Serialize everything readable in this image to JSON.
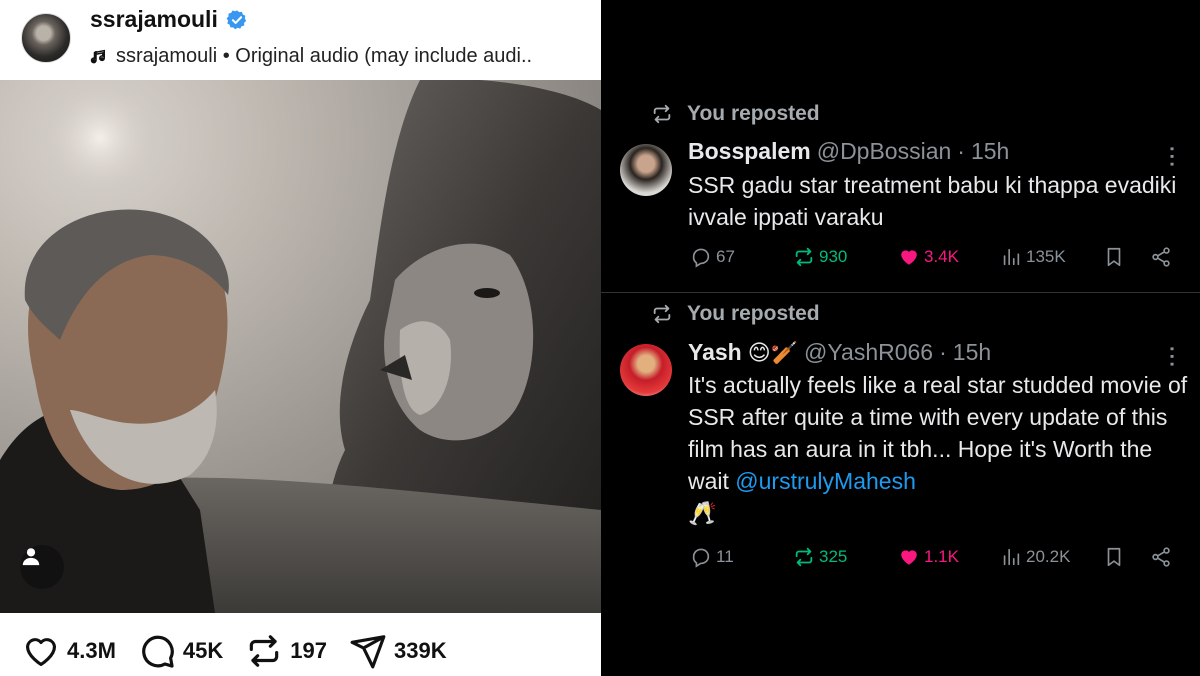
{
  "instagram": {
    "username": "ssrajamouli",
    "audio_label": "ssrajamouli • Original audio (may include audi..",
    "actions": {
      "likes": "4.3M",
      "comments": "45K",
      "reposts": "197",
      "shares": "339K"
    }
  },
  "x_feed": {
    "posts": [
      {
        "repost_label": "You reposted",
        "name": "Bosspalem",
        "name_emoji": "",
        "handle": "@DpBossian",
        "dot": "·",
        "time": "15h",
        "text": "SSR gadu star treatment babu ki thappa evadiki ivvale ippati varaku",
        "mention": "",
        "text_tail": "",
        "stats": {
          "replies": "67",
          "reposts": "930",
          "likes": "3.4K",
          "views": "135K"
        }
      },
      {
        "repost_label": "You reposted",
        "name": "Yash",
        "name_emoji": "😊🏏",
        "handle": "@YashR066",
        "dot": "·",
        "time": "15h",
        "text": "It's actually feels like a real star studded movie of SSR after quite a time with every update of this film has an aura in it tbh... Hope it's Worth the wait ",
        "mention": "@urstrulyMahesh",
        "text_tail": "🥂",
        "stats": {
          "replies": "11",
          "reposts": "325",
          "likes": "1.1K",
          "views": "20.2K"
        }
      }
    ]
  },
  "colors": {
    "x_link": "#1d9bf0",
    "x_repost_green": "#00ba7c",
    "x_like_pink": "#f91880",
    "x_muted": "#8b9298",
    "ig_verified": "#3897f0"
  },
  "icons": [
    "verified-badge-icon",
    "music-note-icon",
    "person-icon",
    "heart-icon",
    "comment-icon",
    "repost-icon",
    "share-icon",
    "reply-icon",
    "views-icon",
    "bookmark-icon",
    "x-share-icon",
    "more-icon"
  ]
}
